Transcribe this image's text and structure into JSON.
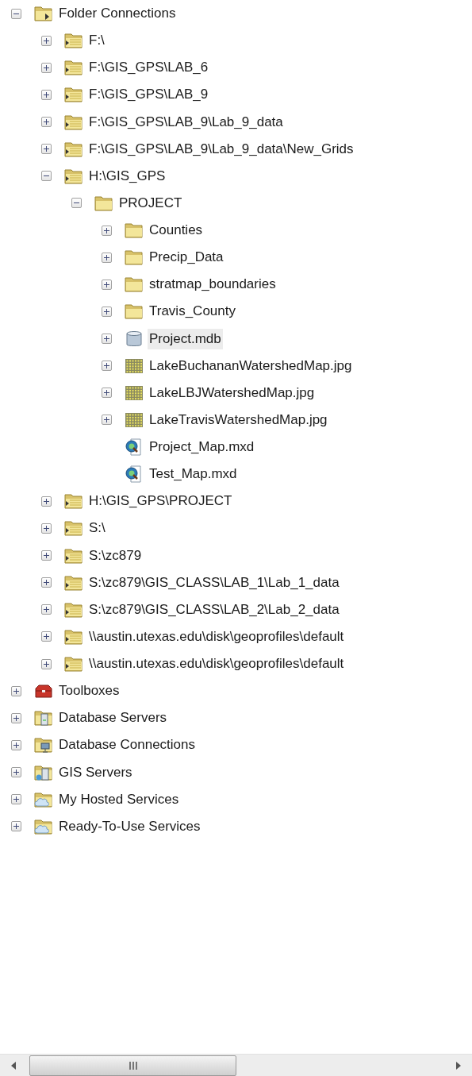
{
  "tree": [
    {
      "label": "Folder Connections",
      "kind": "folder-connections",
      "expanded": true,
      "selected": false,
      "children": [
        {
          "label": "F:\\",
          "kind": "connected-folder",
          "expanded": false,
          "selected": false
        },
        {
          "label": "F:\\GIS_GPS\\LAB_6",
          "kind": "connected-folder",
          "expanded": false,
          "selected": false
        },
        {
          "label": "F:\\GIS_GPS\\LAB_9",
          "kind": "connected-folder",
          "expanded": false,
          "selected": false
        },
        {
          "label": "F:\\GIS_GPS\\LAB_9\\Lab_9_data",
          "kind": "connected-folder",
          "expanded": false,
          "selected": false
        },
        {
          "label": "F:\\GIS_GPS\\LAB_9\\Lab_9_data\\New_Grids",
          "kind": "connected-folder",
          "expanded": false,
          "selected": false
        },
        {
          "label": "H:\\GIS_GPS",
          "kind": "connected-folder",
          "expanded": true,
          "selected": false,
          "children": [
            {
              "label": "PROJECT",
              "kind": "folder",
              "expanded": true,
              "selected": false,
              "children": [
                {
                  "label": "Counties",
                  "kind": "folder",
                  "expanded": false,
                  "selected": false
                },
                {
                  "label": "Precip_Data",
                  "kind": "folder",
                  "expanded": false,
                  "selected": false
                },
                {
                  "label": "stratmap_boundaries",
                  "kind": "folder",
                  "expanded": false,
                  "selected": false
                },
                {
                  "label": "Travis_County",
                  "kind": "folder",
                  "expanded": false,
                  "selected": false
                },
                {
                  "label": "Project.mdb",
                  "kind": "database",
                  "expanded": false,
                  "selected": true
                },
                {
                  "label": "LakeBuchananWatershedMap.jpg",
                  "kind": "raster",
                  "expanded": false,
                  "selected": false
                },
                {
                  "label": "LakeLBJWatershedMap.jpg",
                  "kind": "raster",
                  "expanded": false,
                  "selected": false
                },
                {
                  "label": "LakeTravisWatershedMap.jpg",
                  "kind": "raster",
                  "expanded": false,
                  "selected": false
                },
                {
                  "label": "Project_Map.mxd",
                  "kind": "map-document",
                  "selected": false
                },
                {
                  "label": "Test_Map.mxd",
                  "kind": "map-document",
                  "selected": false
                }
              ]
            }
          ]
        },
        {
          "label": "H:\\GIS_GPS\\PROJECT",
          "kind": "connected-folder",
          "expanded": false,
          "selected": false
        },
        {
          "label": "S:\\",
          "kind": "connected-folder",
          "expanded": false,
          "selected": false
        },
        {
          "label": "S:\\zc879",
          "kind": "connected-folder",
          "expanded": false,
          "selected": false
        },
        {
          "label": "S:\\zc879\\GIS_CLASS\\LAB_1\\Lab_1_data",
          "kind": "connected-folder",
          "expanded": false,
          "selected": false
        },
        {
          "label": "S:\\zc879\\GIS_CLASS\\LAB_2\\Lab_2_data",
          "kind": "connected-folder",
          "expanded": false,
          "selected": false
        },
        {
          "label": "\\\\austin.utexas.edu\\disk\\geoprofiles\\default",
          "kind": "connected-folder",
          "expanded": false,
          "selected": false
        },
        {
          "label": "\\\\austin.utexas.edu\\disk\\geoprofiles\\default",
          "kind": "connected-folder",
          "expanded": false,
          "selected": false
        }
      ]
    },
    {
      "label": "Toolboxes",
      "kind": "toolbox",
      "expanded": false,
      "selected": false
    },
    {
      "label": "Database Servers",
      "kind": "database-server",
      "expanded": false,
      "selected": false
    },
    {
      "label": "Database Connections",
      "kind": "database-connection",
      "expanded": false,
      "selected": false
    },
    {
      "label": "GIS Servers",
      "kind": "gis-server",
      "expanded": false,
      "selected": false
    },
    {
      "label": "My Hosted Services",
      "kind": "cloud-folder",
      "expanded": false,
      "selected": false
    },
    {
      "label": "Ready-To-Use Services",
      "kind": "cloud-folder",
      "expanded": false,
      "selected": false
    }
  ]
}
